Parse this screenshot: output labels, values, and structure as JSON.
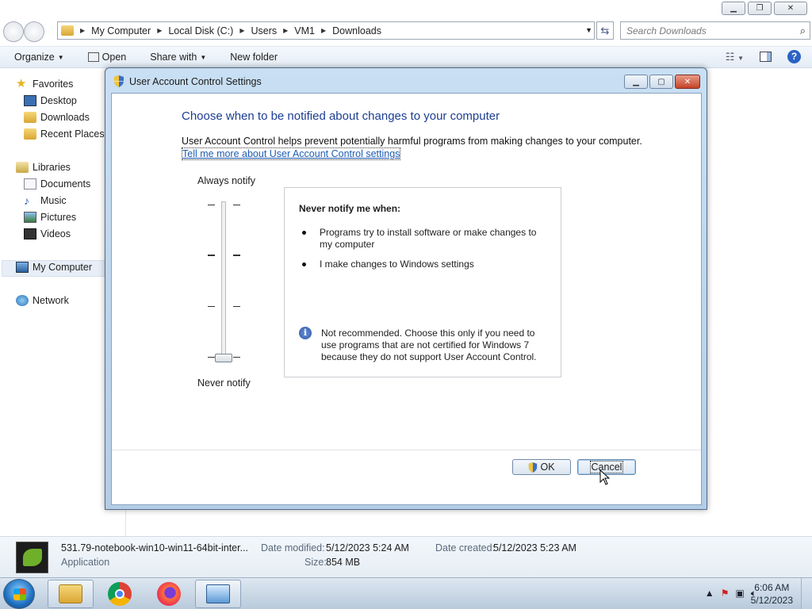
{
  "explorer": {
    "address": [
      "My Computer",
      "Local Disk (C:)",
      "Users",
      "VM1",
      "Downloads"
    ],
    "search_placeholder": "Search Downloads",
    "toolbar": {
      "organize": "Organize",
      "open": "Open",
      "share_with": "Share with",
      "new_folder": "New folder"
    },
    "sidebar": {
      "favorites": "Favorites",
      "desktop": "Desktop",
      "downloads": "Downloads",
      "recent_places": "Recent Places",
      "libraries": "Libraries",
      "documents": "Documents",
      "music": "Music",
      "pictures": "Pictures",
      "videos": "Videos",
      "my_computer": "My Computer",
      "network": "Network"
    },
    "details": {
      "filename": "531.79-notebook-win10-win11-64bit-inter...",
      "type": "Application",
      "date_modified_label": "Date modified:",
      "date_modified": "5/12/2023 5:24 AM",
      "date_created_label": "Date created:",
      "date_created": "5/12/2023 5:23 AM",
      "size_label": "Size:",
      "size": "854 MB"
    }
  },
  "uac": {
    "title": "User Account Control Settings",
    "heading": "Choose when to be notified about changes to your computer",
    "description": "User Account Control helps prevent potentially harmful programs from making changes to your computer.",
    "link": "Tell me more about User Account Control settings",
    "slider_top": "Always notify",
    "slider_bottom": "Never notify",
    "slider_level": 0,
    "info_heading": "Never notify me when:",
    "bullet1": "Programs try to install software or make changes to my computer",
    "bullet2": "I make changes to Windows settings",
    "note": "Not recommended. Choose this only if you need to use programs that are not certified for Windows 7 because they do not support User Account Control.",
    "ok": "OK",
    "cancel": "Cancel"
  },
  "taskbar": {
    "time": "6:06 AM",
    "date": "5/12/2023"
  }
}
